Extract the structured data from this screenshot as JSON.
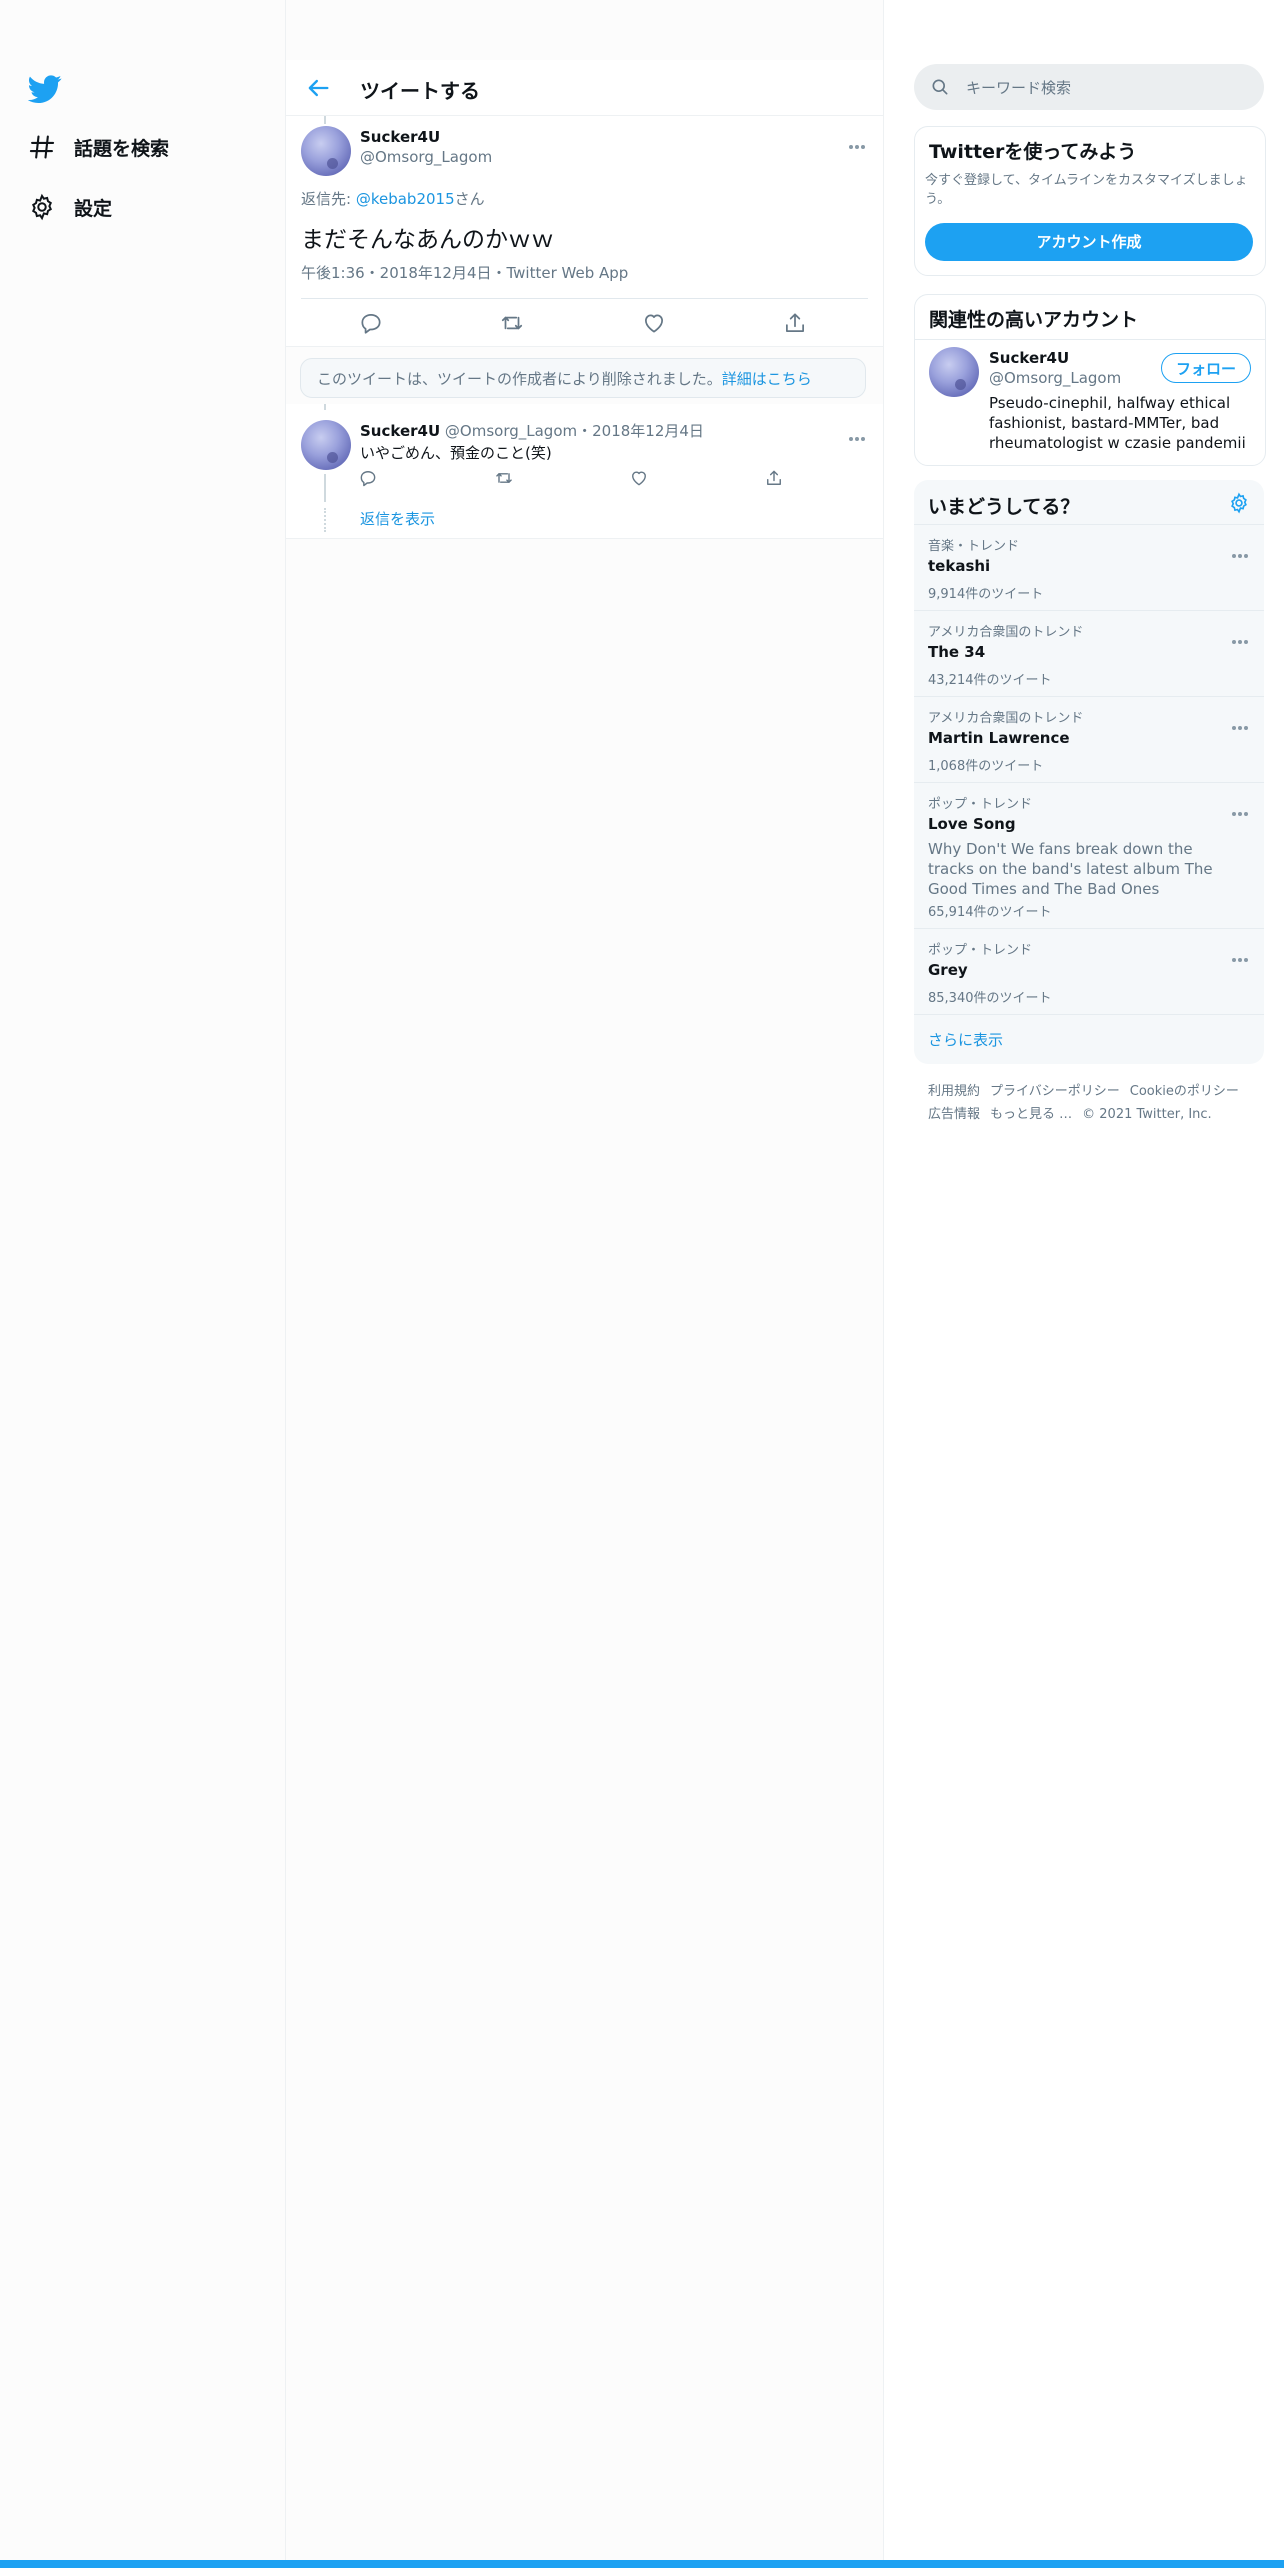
{
  "nav": {
    "explore_label": "話題を検索",
    "settings_label": "設定"
  },
  "header": {
    "title": "ツイートする"
  },
  "main_tweet": {
    "name": "Sucker4U",
    "handle": "@Omsorg_Lagom",
    "reply_prefix": "返信先: ",
    "reply_to": "@kebab2015",
    "reply_suffix": "さん",
    "text": "まだそんなあんのかｗｗ",
    "meta": "午後1:36・2018年12月4日・Twitter Web App"
  },
  "deleted_notice": {
    "text": "このツイートは、ツイートの作成者により削除されました。",
    "link": "詳細はこちら"
  },
  "reply_tweet": {
    "name": "Sucker4U",
    "handle": "@Omsorg_Lagom",
    "date": "・2018年12月4日",
    "text": "いやごめん、預金のこと(笑)",
    "show_replies": "返信を表示"
  },
  "search": {
    "placeholder": "キーワード検索"
  },
  "signup_card": {
    "title": "Twitterを使ってみよう",
    "desc": "今すぐ登録して、タイムラインをカスタマイズしましょう。",
    "button": "アカウント作成"
  },
  "related_card": {
    "title": "関連性の高いアカウント",
    "name": "Sucker4U",
    "handle": "@Omsorg_Lagom",
    "follow": "フォロー",
    "bio": "Pseudo-cinephil, halfway ethical fashionist, bastard-MMTer, bad rheumatologist w czasie pandemii"
  },
  "trends": {
    "title": "いまどうしてる？",
    "items": [
      {
        "category": "音楽・トレンド",
        "name": "tekashi",
        "desc": "",
        "count": "9,914件のツイート"
      },
      {
        "category": "アメリカ合衆国のトレンド",
        "name": "The 34",
        "desc": "",
        "count": "43,214件のツイート"
      },
      {
        "category": "アメリカ合衆国のトレンド",
        "name": "Martin Lawrence",
        "desc": "",
        "count": "1,068件のツイート"
      },
      {
        "category": "ポップ・トレンド",
        "name": "Love Song",
        "desc": "Why Don't We fans break down the tracks on the band's latest album The Good Times and The Bad Ones",
        "count": "65,914件のツイート"
      },
      {
        "category": "ポップ・トレンド",
        "name": "Grey",
        "desc": "",
        "count": "85,340件のツイート"
      }
    ],
    "show_more": "さらに表示"
  },
  "footer": {
    "terms": "利用規約",
    "privacy": "プライバシーポリシー",
    "cookie": "Cookieのポリシー",
    "ads": "広告情報",
    "more": "もっと見る …",
    "copyright": "© 2021 Twitter, Inc."
  },
  "colors": {
    "accent": "#1da1f2",
    "link": "#1b95e0",
    "secondary_text": "#657786"
  },
  "icons": [
    "twitter-bird-icon",
    "hashtag-icon",
    "gear-icon",
    "back-arrow-icon",
    "search-icon",
    "reply-icon",
    "retweet-icon",
    "like-icon",
    "share-icon",
    "more-icon"
  ]
}
